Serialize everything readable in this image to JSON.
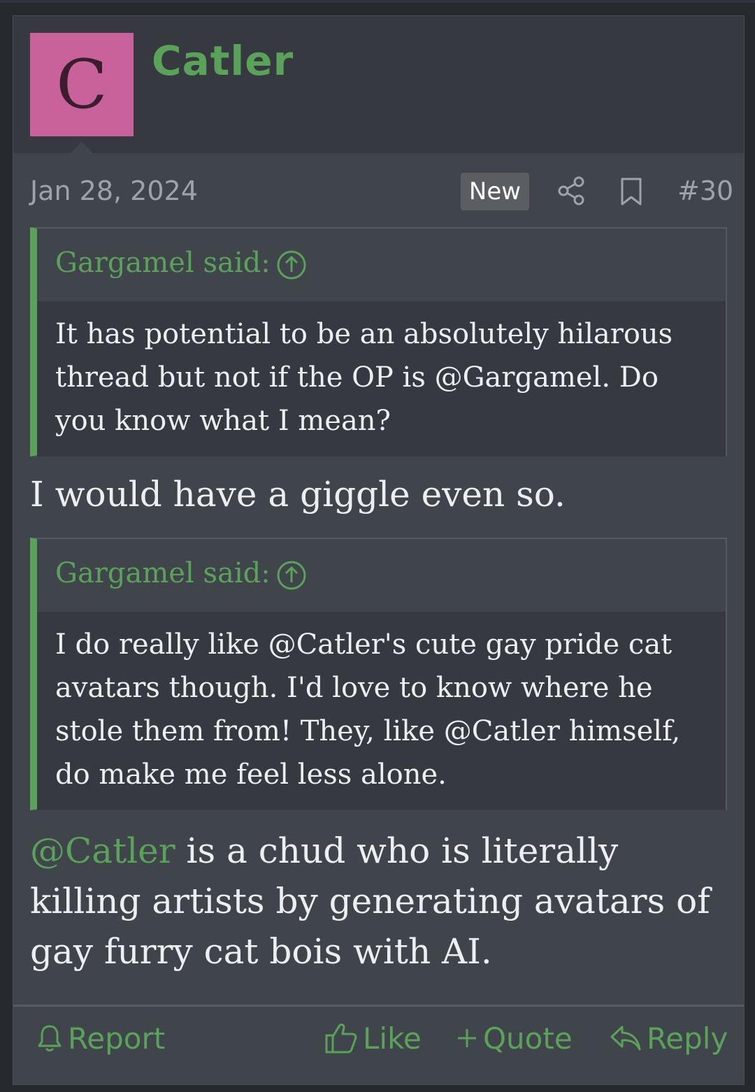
{
  "post": {
    "avatar_letter": "C",
    "username": "Catler",
    "date": "Jan 28, 2024",
    "new_badge": "New",
    "post_number": "#30",
    "quotes": [
      {
        "author": "Gargamel said:",
        "text": "It has potential to be an absolutely hilarous thread but not if the OP is @Gargamel. Do you know what I mean?"
      },
      {
        "author": "Gargamel said:",
        "text": "I do really like @Catler's cute gay pride cat avatars though. I'd love to know where he stole them from! They, like @Catler himself, do make me feel less alone."
      }
    ],
    "replies": [
      {
        "text": "I would have a giggle even so."
      },
      {
        "mention": "@Catler",
        "text": " is a chud who is literally killing artists by generating avatars of gay furry cat bois with AI."
      }
    ]
  },
  "actions": {
    "report": "Report",
    "like": "Like",
    "quote": "Quote",
    "reply": "Reply"
  },
  "icons": {
    "share": "share-icon",
    "bookmark": "bookmark-icon",
    "up": "arrow-up-circle-icon",
    "bell": "bell-icon",
    "like": "thumbs-up-icon",
    "plus": "plus-icon",
    "reply": "reply-arrow-icon"
  },
  "colors": {
    "accent": "#5aa25a",
    "avatar_bg": "#c9629b",
    "post_bg": "#40444b",
    "header_bg": "#363a40"
  }
}
